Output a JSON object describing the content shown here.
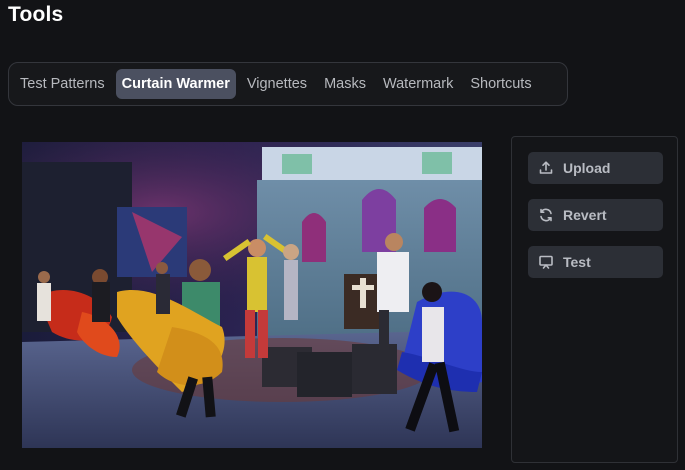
{
  "header": {
    "title": "Tools"
  },
  "tabs": [
    {
      "label": "Test Patterns",
      "active": false
    },
    {
      "label": "Curtain Warmer",
      "active": true
    },
    {
      "label": "Vignettes",
      "active": false
    },
    {
      "label": "Masks",
      "active": false
    },
    {
      "label": "Watermark",
      "active": false
    },
    {
      "label": "Shortcuts",
      "active": false
    }
  ],
  "actions": {
    "upload": {
      "label": "Upload",
      "icon": "upload-icon"
    },
    "revert": {
      "label": "Revert",
      "icon": "refresh-icon"
    },
    "test": {
      "label": "Test",
      "icon": "cast-icon"
    }
  },
  "colors": {
    "background": "#121316",
    "tab_active": "#4b5060",
    "button_bg": "#2c2f36"
  }
}
